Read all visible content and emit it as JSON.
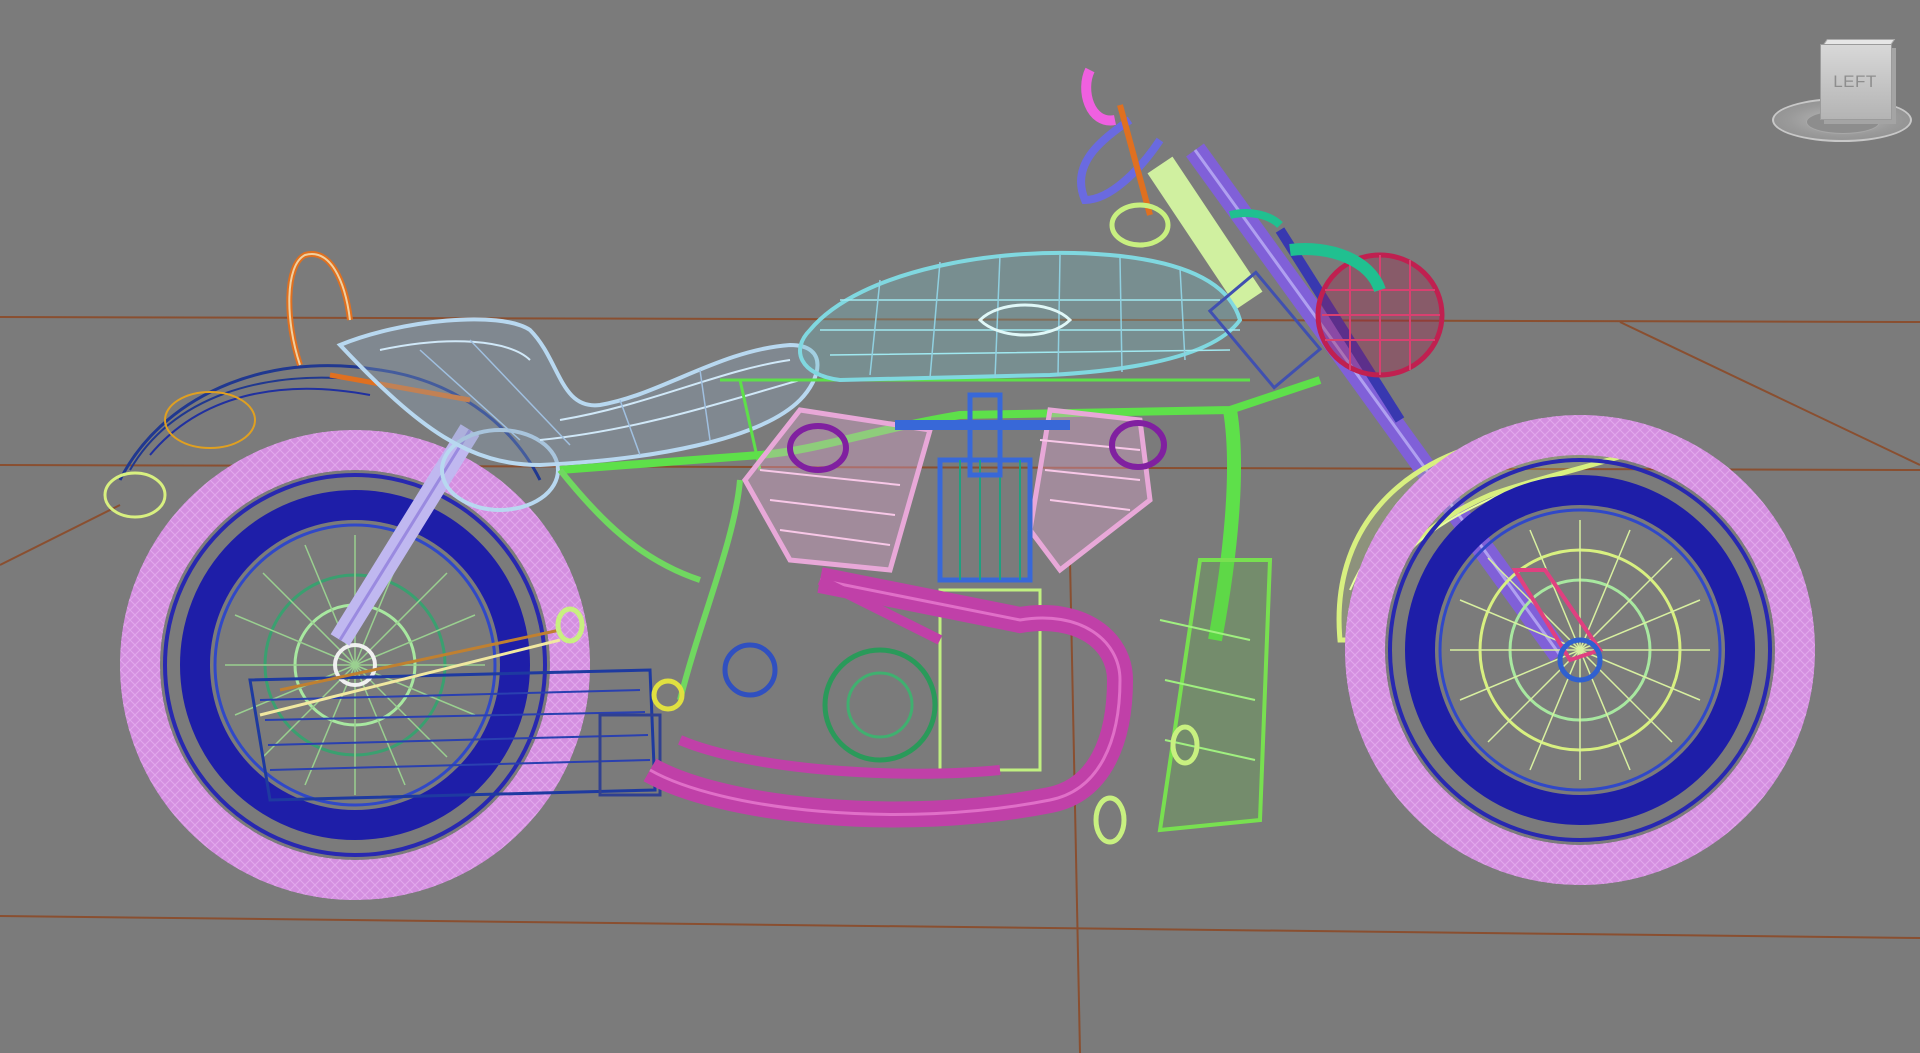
{
  "viewport": {
    "background": "#7b7b7b",
    "grid_color": "#8a4f30"
  },
  "viewcube": {
    "face_label": "LEFT"
  },
  "model": {
    "colors": {
      "tire": "#d48fe0",
      "rim_dark": "#1e1ea8",
      "spokes": "#a8e8a0",
      "frame_green": "#5ee04a",
      "tank": "#80d8e0",
      "seat": "#b8d8f0",
      "exhaust": "#c040a8",
      "engine_pink": "#e8a8d8",
      "engine_blue": "#3868d8",
      "headlight": "#c02050",
      "fender_yellow": "#d8f080",
      "orange": "#e07020",
      "purple": "#8020a0",
      "navy": "#203890"
    }
  }
}
